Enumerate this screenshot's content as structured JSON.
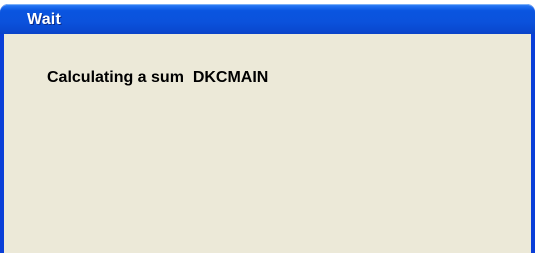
{
  "window": {
    "title": "Wait",
    "message": "Calculating a sum  DKCMAIN"
  },
  "colors": {
    "titlebar": "#0a52dc",
    "title_text": "#ffffff",
    "client_background": "#ece9d8",
    "message_text": "#000000"
  }
}
